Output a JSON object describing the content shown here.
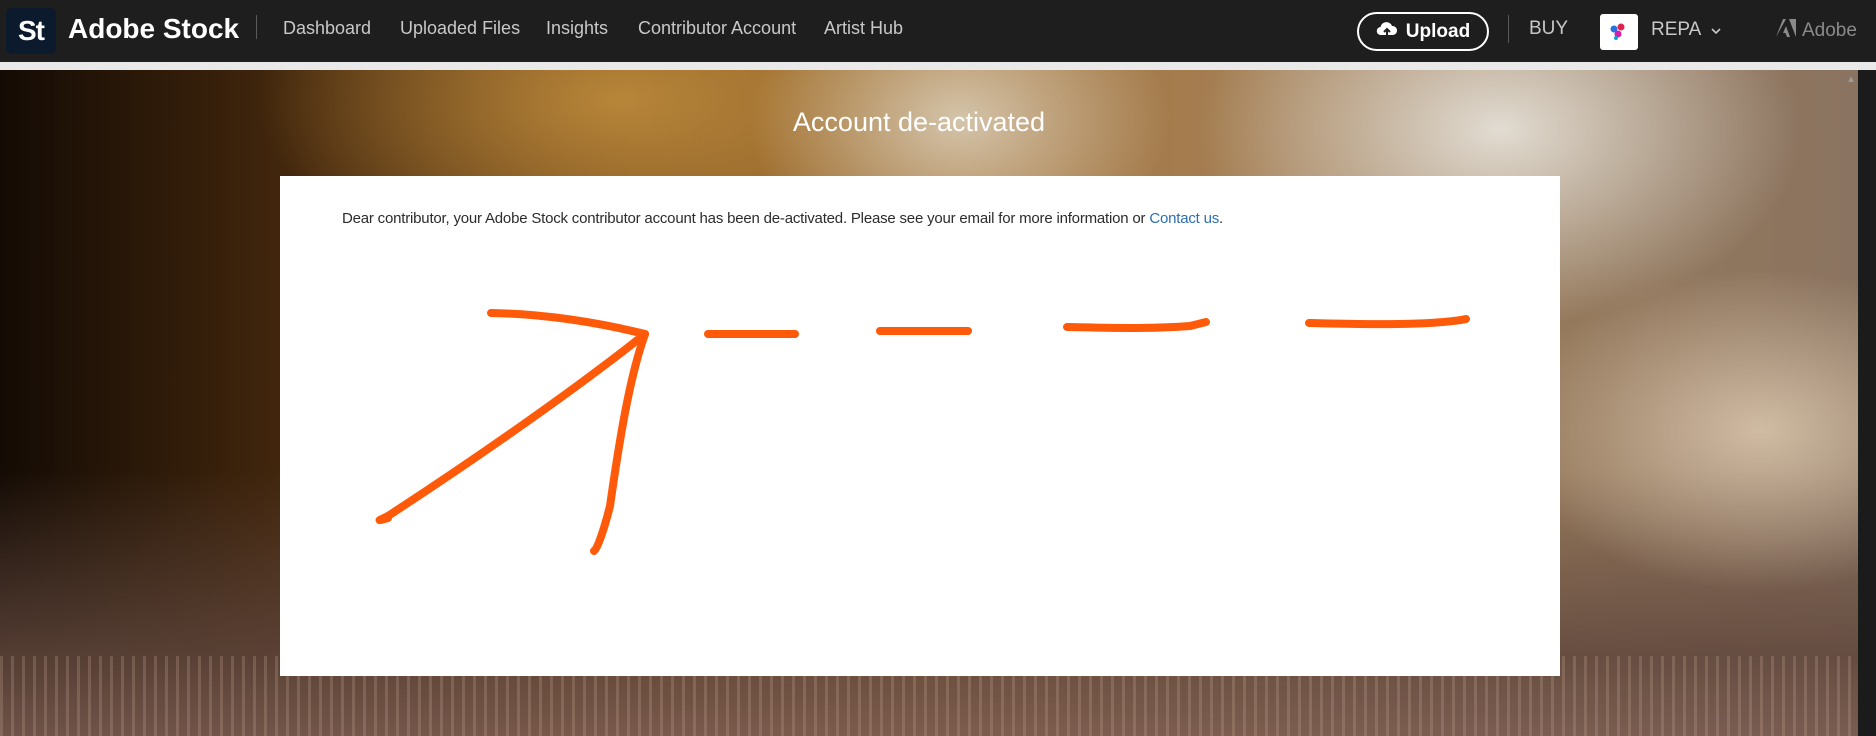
{
  "header": {
    "logo_text": "St",
    "brand": "Adobe Stock",
    "nav": [
      "Dashboard",
      "Uploaded Files",
      "Insights",
      "Contributor Account",
      "Artist Hub"
    ],
    "upload_label": "Upload",
    "buy_label": "BUY",
    "user_name": "REPA",
    "adobe_label": "Adobe"
  },
  "page": {
    "title": "Account de-activated",
    "message": "Dear contributor, your Adobe Stock contributor account has been de-activated. Please see your email for more information or ",
    "link_text": "Contact us",
    "message_end": "."
  },
  "annotation": {
    "color": "#ff5a0a",
    "icon": "hand-drawn-arrow"
  }
}
